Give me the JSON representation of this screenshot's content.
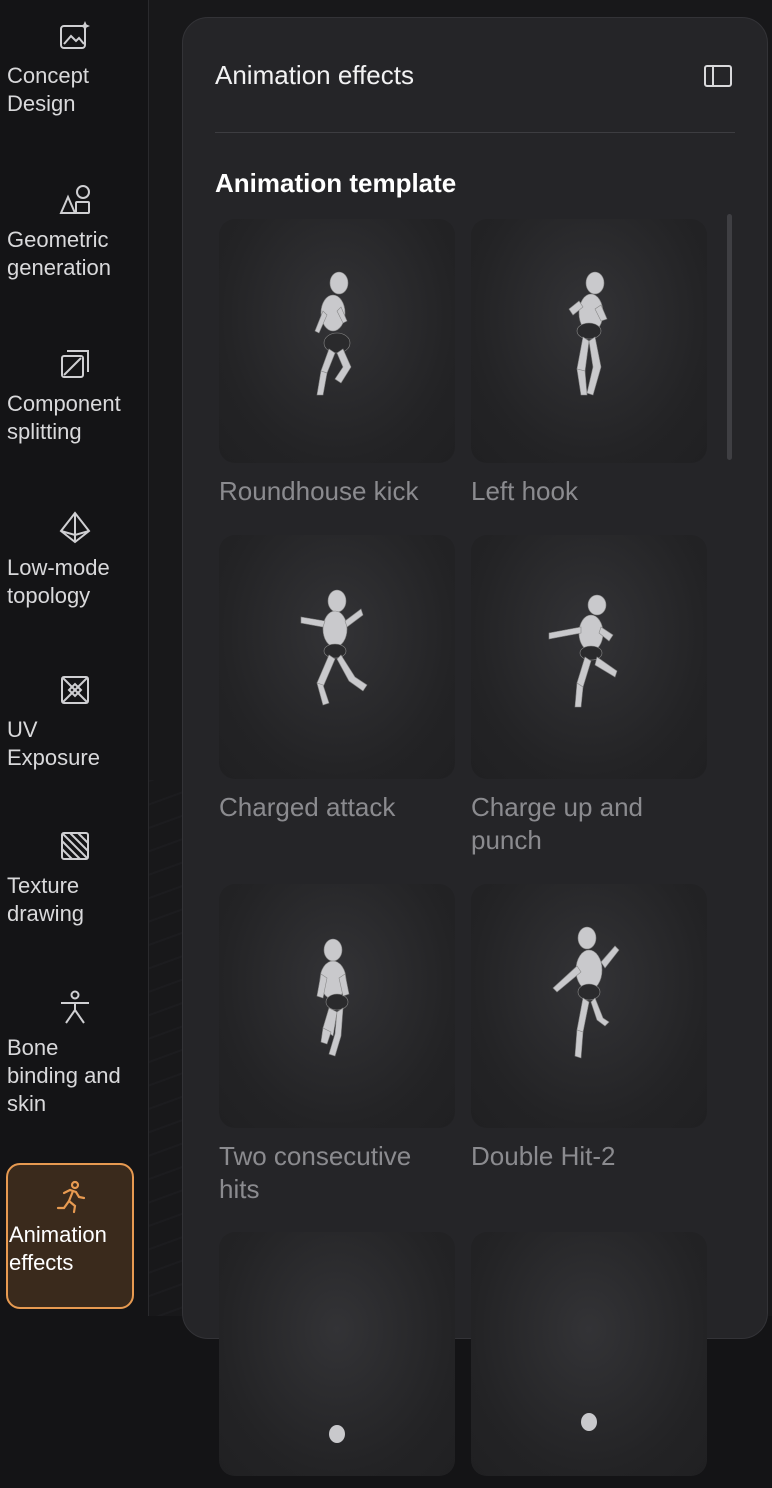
{
  "sidebar": {
    "items": [
      {
        "label": "Concept Design",
        "icon": "image-sparkle-icon"
      },
      {
        "label": "Geometric generation",
        "icon": "shapes-icon"
      },
      {
        "label": "Component splitting",
        "icon": "split-box-icon"
      },
      {
        "label": "Low-mode topology",
        "icon": "diamond-mesh-icon"
      },
      {
        "label": "UV Exposure",
        "icon": "uv-box-icon"
      },
      {
        "label": "Texture drawing",
        "icon": "hatched-square-icon"
      },
      {
        "label": "Bone binding and skin",
        "icon": "stick-figure-icon"
      },
      {
        "label": "Animation effects",
        "icon": "running-figure-icon",
        "active": true
      }
    ]
  },
  "panel": {
    "title": "Animation effects",
    "toggle_icon": "sidebar-toggle-icon",
    "section_title": "Animation template",
    "templates": [
      {
        "name": "Roundhouse kick"
      },
      {
        "name": "Left hook"
      },
      {
        "name": "Charged attack"
      },
      {
        "name": "Charge up and punch"
      },
      {
        "name": "Two consecutive hits"
      },
      {
        "name": "Double Hit-2"
      },
      {
        "name": ""
      },
      {
        "name": ""
      }
    ]
  },
  "colors": {
    "accent": "#e79a51",
    "panel_bg": "#252528",
    "rail_bg": "#141416",
    "muted_text": "#8b8b8f"
  }
}
